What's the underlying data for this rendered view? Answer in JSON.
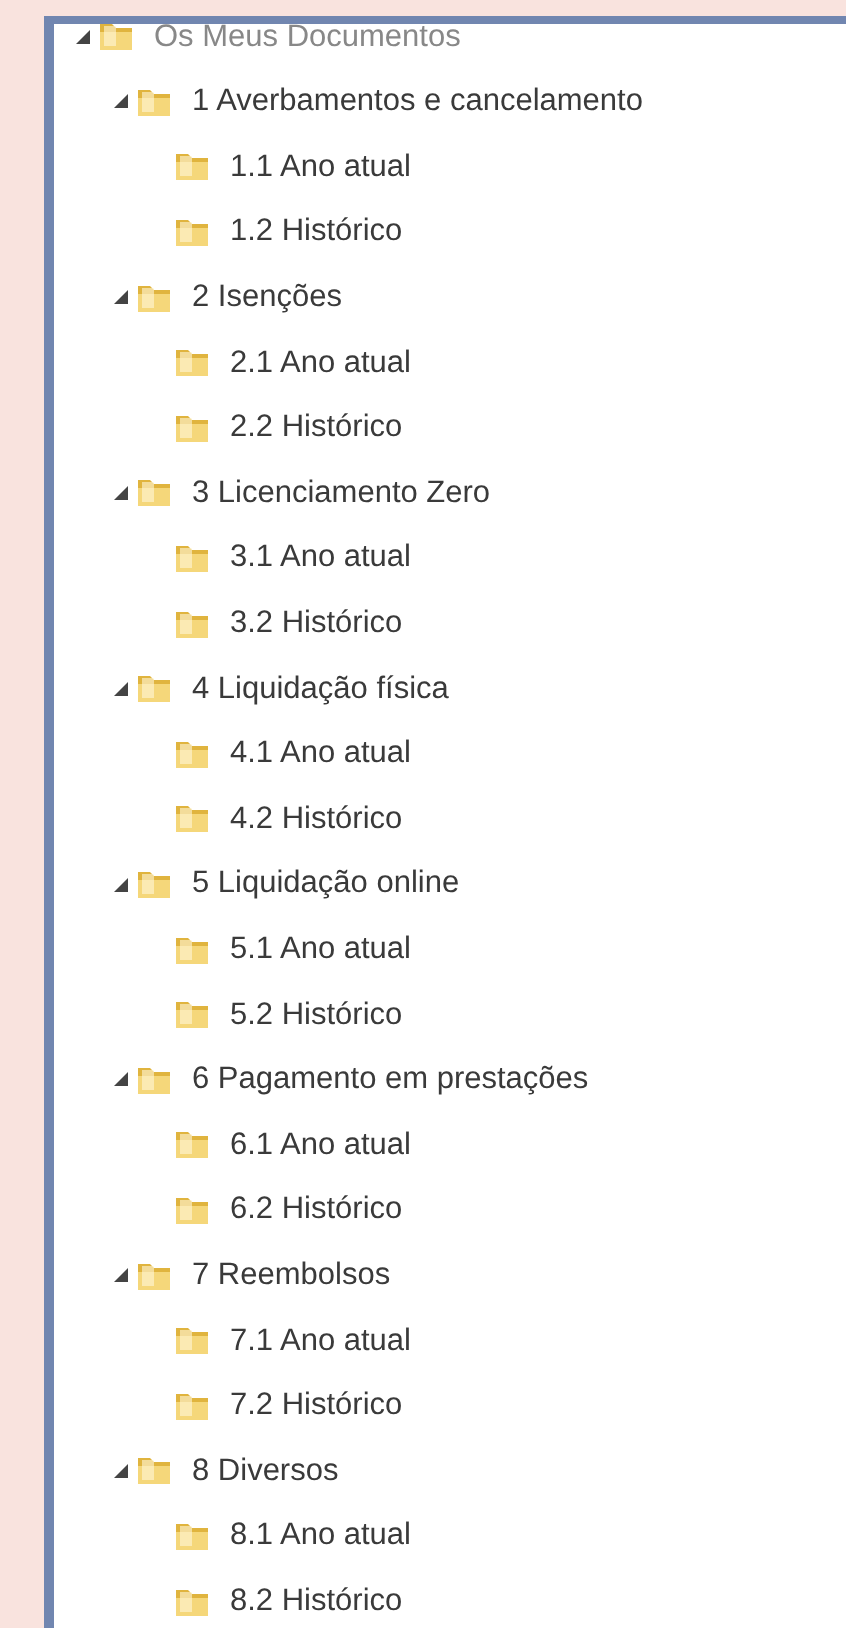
{
  "tree": [
    {
      "label": "Os Meus Documentos",
      "expanded": true,
      "children": [
        {
          "label": "1 Averbamentos e cancelamento",
          "expanded": true,
          "children": [
            {
              "label": "1.1 Ano atual"
            },
            {
              "label": "1.2 Histórico"
            }
          ]
        },
        {
          "label": "2 Isenções",
          "expanded": true,
          "children": [
            {
              "label": "2.1 Ano atual"
            },
            {
              "label": "2.2 Histórico"
            }
          ]
        },
        {
          "label": "3 Licenciamento Zero",
          "expanded": true,
          "children": [
            {
              "label": "3.1 Ano atual"
            },
            {
              "label": "3.2 Histórico"
            }
          ]
        },
        {
          "label": "4 Liquidação física",
          "expanded": true,
          "children": [
            {
              "label": "4.1 Ano atual"
            },
            {
              "label": "4.2 Histórico"
            }
          ]
        },
        {
          "label": "5 Liquidação online",
          "expanded": true,
          "children": [
            {
              "label": "5.1 Ano atual"
            },
            {
              "label": "5.2 Histórico"
            }
          ]
        },
        {
          "label": "6 Pagamento em prestações",
          "expanded": true,
          "children": [
            {
              "label": "6.1 Ano atual"
            },
            {
              "label": "6.2 Histórico"
            }
          ]
        },
        {
          "label": "7 Reembolsos",
          "expanded": true,
          "children": [
            {
              "label": "7.1 Ano atual"
            },
            {
              "label": "7.2 Histórico"
            }
          ]
        },
        {
          "label": "8 Diversos",
          "expanded": true,
          "children": [
            {
              "label": "8.1 Ano atual"
            },
            {
              "label": "8.2 Histórico"
            }
          ]
        }
      ]
    }
  ]
}
